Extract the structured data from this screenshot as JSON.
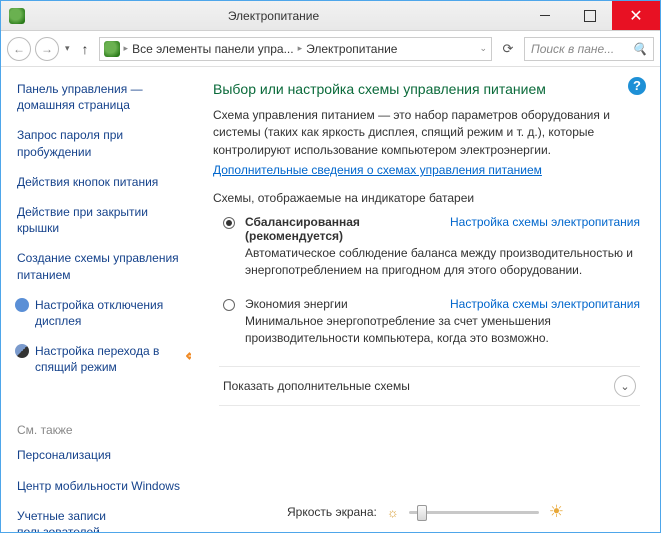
{
  "title": "Электропитание",
  "breadcrumb": {
    "part1": "Все элементы панели упра...",
    "part2": "Электропитание"
  },
  "search_placeholder": "Поиск в пане...",
  "sidebar": {
    "items": [
      "Панель управления — домашняя страница",
      "Запрос пароля при пробуждении",
      "Действия кнопок питания",
      "Действие при закрытии крышки",
      "Создание схемы управления питанием",
      "Настройка отключения дисплея",
      "Настройка перехода в спящий режим"
    ],
    "see_also_label": "См. также",
    "see_also": [
      "Персонализация",
      "Центр мобильности Windows",
      "Учетные записи пользователей"
    ]
  },
  "main": {
    "heading": "Выбор или настройка схемы управления питанием",
    "description": "Схема управления питанием — это набор параметров оборудования и системы (таких как яркость дисплея, спящий режим и т. д.), которые контролируют использование компьютером электроэнергии.",
    "more_info_link": "Дополнительные сведения о схемах управления питанием",
    "section_label": "Схемы, отображаемые на индикаторе батареи",
    "plans": [
      {
        "name": "Сбалансированная (рекомендуется)",
        "link": "Настройка схемы электропитания",
        "desc": "Автоматическое соблюдение баланса между производительностью и энергопотреблением на пригодном для этого оборудовании.",
        "selected": true
      },
      {
        "name": "Экономия энергии",
        "link": "Настройка схемы электропитания",
        "desc": "Минимальное энергопотребление за счет уменьшения производительности компьютера, когда это возможно.",
        "selected": false
      }
    ],
    "expand_label": "Показать дополнительные схемы",
    "brightness_label": "Яркость экрана:"
  }
}
